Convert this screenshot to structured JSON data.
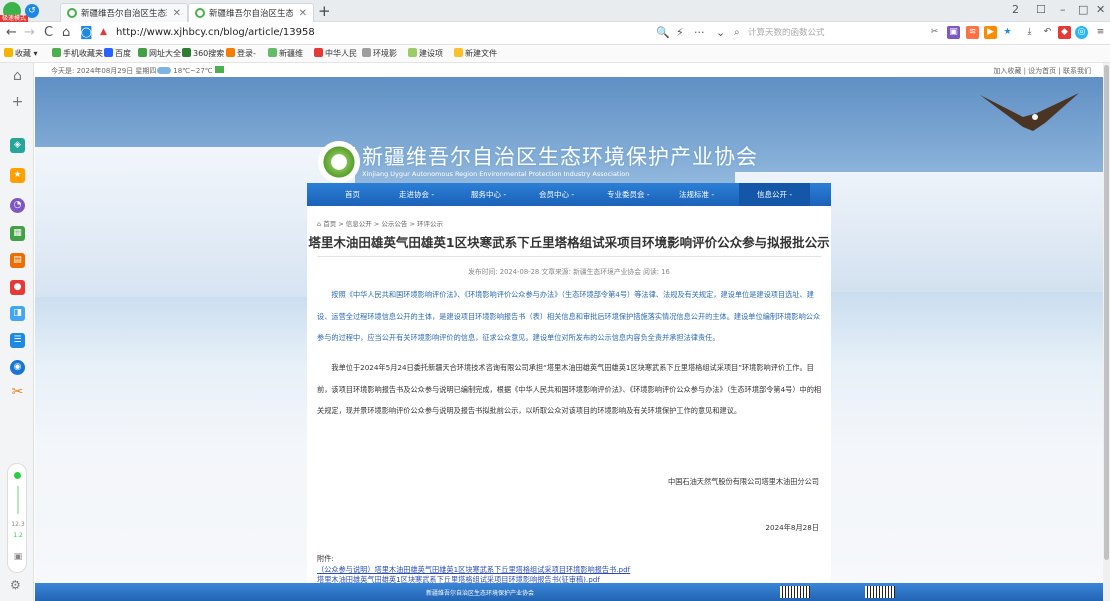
{
  "browser": {
    "badge": "极速模式",
    "tabs": [
      {
        "title": "新疆维吾尔自治区生态环境保",
        "active": false
      },
      {
        "title": "新疆维吾尔自治区生态环境保",
        "active": true
      }
    ],
    "new_tab": "+",
    "url": "http://www.xjhbcy.cn/blog/article/13958",
    "search_placeholder": "计算天数的函数公式",
    "window_controls": [
      "2",
      "☐",
      "–",
      "□",
      "✕"
    ]
  },
  "bookmarks": [
    {
      "label": "收藏",
      "color": "#f5b400"
    },
    {
      "label": "手机收藏夹",
      "color": "#4caf50"
    },
    {
      "label": "百度",
      "color": "#2962ff"
    },
    {
      "label": "网址大全",
      "color": "#43a047"
    },
    {
      "label": "360搜索",
      "color": "#2e7d32"
    },
    {
      "label": "登录-",
      "color": "#f57c00"
    },
    {
      "label": "新疆维",
      "color": "#66bb6a"
    },
    {
      "label": "中华人民",
      "color": "#e53935"
    },
    {
      "label": "环境影",
      "color": "#9e9e9e"
    },
    {
      "label": "建设项",
      "color": "#9ccc65"
    },
    {
      "label": "新建文件",
      "color": "#fbc02d"
    }
  ],
  "side_speed": {
    "line1": "12.3",
    "line2": "1.2"
  },
  "site": {
    "date": "今天是: 2024年08月29日 星期四",
    "weather": "18℃~27℃",
    "top_links": "加入收藏 | 设为首页 | 联系我们",
    "title": "新疆维吾尔自治区生态环境保护产业协会",
    "subtitle": "Xinjiang Uygur Autonomous Region Environmental Protection Industry Association",
    "nav": [
      {
        "label": "首页",
        "selected": false
      },
      {
        "label": "走进协会 -",
        "selected": false
      },
      {
        "label": "服务中心 -",
        "selected": false
      },
      {
        "label": "会员中心 -",
        "selected": false
      },
      {
        "label": "专业委员会 -",
        "selected": false
      },
      {
        "label": "法规标准 -",
        "selected": false
      },
      {
        "label": "信息公开 -",
        "selected": true
      }
    ],
    "breadcrumb": "首页 > 信息公开 > 公示公告 > 环评公示",
    "article": {
      "title": "塔里木油田雄英气田雄英1区块寒武系下丘里塔格组试采项目环境影响评价公众参与拟报批公示",
      "meta": "发布时间: 2024-08-28   文章来源: 新疆生态环境产业协会   阅读: 16",
      "para1": "按照《中华人民共和国环境影响评价法》、《环境影响评价公众参与办法》（生态环境部令第4号）等法律、法规及有关规定，建设单位是建设项目选址、建设、运营全过程环境信息公开的主体，是建设项目环境影响报告书（表）相关信息和审批后环境保护措施落实情况信息公开的主体。建设单位编制环境影响公众参与的过程中，应当公开有关环境影响评价的信息，征求公众意见。建设单位对所发布的公示信息内容负全责并承担法律责任。",
      "para2": "我单位于2024年5月24日委托新疆天合环境技术咨询有限公司承担“塔里木油田雄英气田雄英1区块寒武系下丘里塔格组试采项目”环境影响评价工作。目前，该项目环境影响报告书及公众参与说明已编制完成，根据《中华人民共和国环境影响评价法》、《环境影响评价公众参与办法》（生态环境部令第4号）中的相关规定，现并景环境影响评价公众参与说明及报告书拟批前公示，以听取公众对该项目的环境影响及有关环境保护工作的意见和建议。",
      "signer": "中国石油天然气股份有限公司塔里木油田分公司",
      "sign_date": "2024年8月28日",
      "attach_label": "附件:",
      "attachments": [
        "（公众参与说明）塔里木油田雄英气田雄英1区块寒武系下丘里塔格组试采项目环境影响报告书.pdf",
        "塔里木油田雄英气田雄英1区块寒武系下丘里塔格组试采项目环境影响报告书(征审稿).pdf"
      ]
    },
    "footer_text": "新疆维吾尔自治区生态环境保护产业协会"
  }
}
